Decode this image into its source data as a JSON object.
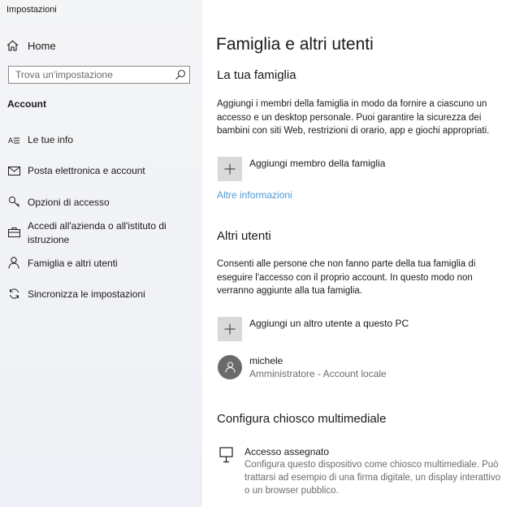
{
  "window": {
    "title": "Impostazioni"
  },
  "sidebar": {
    "home_label": "Home",
    "search": {
      "placeholder": "Trova un'impostazione"
    },
    "section_title": "Account",
    "items": [
      {
        "label": "Le tue info",
        "icon": "contact-card-icon"
      },
      {
        "label": "Posta elettronica e account",
        "icon": "mail-icon"
      },
      {
        "label": "Opzioni di accesso",
        "icon": "key-icon"
      },
      {
        "label": "Accedi all'azienda o all'istituto di istruzione",
        "icon": "briefcase-icon"
      },
      {
        "label": "Famiglia e altri utenti",
        "icon": "person-icon",
        "selected": true
      },
      {
        "label": "Sincronizza le impostazioni",
        "icon": "sync-icon"
      }
    ]
  },
  "main": {
    "title": "Famiglia e altri utenti",
    "family": {
      "heading": "La tua famiglia",
      "description": "Aggiungi i membri della famiglia in modo da fornire a ciascuno un accesso e un desktop personale. Puoi garantire la sicurezza dei bambini con siti Web, restrizioni di orario, app e giochi appropriati.",
      "add_label": "Aggiungi membro della famiglia",
      "more_info_link": "Altre informazioni"
    },
    "others": {
      "heading": "Altri utenti",
      "description": "Consenti alle persone che non fanno parte della tua famiglia di eseguire l'accesso con il proprio account. In questo modo non verranno aggiunte alla tua famiglia.",
      "add_label": "Aggiungi un altro utente a questo PC",
      "user": {
        "name": "michele",
        "role": "Amministratore - Account locale"
      }
    },
    "kiosk": {
      "heading": "Configura chiosco multimediale",
      "title": "Accesso assegnato",
      "description": "Configura questo dispositivo come chiosco multimediale. Può trattarsi ad esempio di una firma digitale, un display interattivo o un browser pubblico."
    }
  },
  "colors": {
    "link": "#4a9bd9",
    "sidebar_bg": "#f2f3f6",
    "tile_bg": "#d9d9d9",
    "avatar_bg": "#6a6a6a"
  }
}
